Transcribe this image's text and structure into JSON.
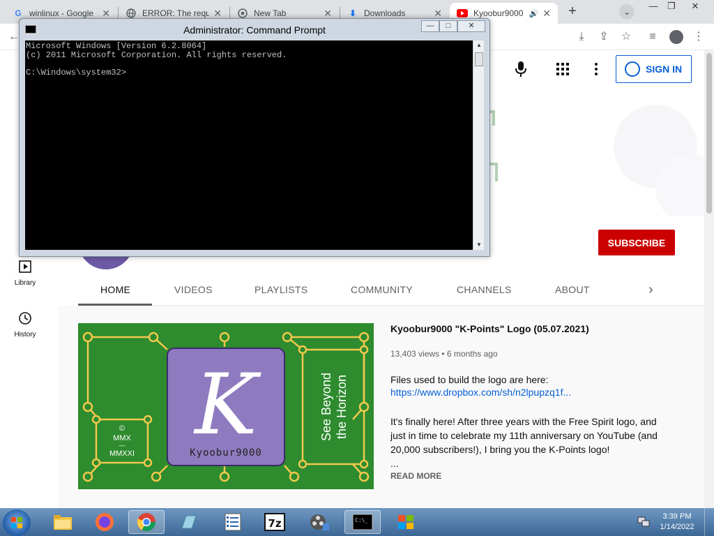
{
  "browser": {
    "tabs": [
      {
        "title": "winlinux - Google",
        "icon": "google-icon"
      },
      {
        "title": "ERROR: The requ",
        "icon": "globe-icon"
      },
      {
        "title": "New Tab",
        "icon": "chrome-icon"
      },
      {
        "title": "Downloads",
        "icon": "download-icon"
      },
      {
        "title": "Kyoobur9000",
        "icon": "youtube-icon",
        "active": true
      }
    ],
    "new_tab": "+",
    "window_controls": [
      "—",
      "❐",
      "✕"
    ]
  },
  "cmd": {
    "title": "Administrator: Command Prompt",
    "lines": [
      "Microsoft Windows [Version 6.2.8064]",
      "(c) 2011 Microsoft Corporation. All rights reserved.",
      "",
      "C:\\Windows\\system32>"
    ],
    "buttons": [
      "—",
      "□",
      "✕"
    ]
  },
  "youtube": {
    "sign_in": "SIGN IN",
    "subscribe": "SUBSCRIBE",
    "sidebar": [
      {
        "label": "Library",
        "icon": "library-icon"
      },
      {
        "label": "History",
        "icon": "history-icon"
      }
    ],
    "tabs": [
      "HOME",
      "VIDEOS",
      "PLAYLISTS",
      "COMMUNITY",
      "CHANNELS",
      "ABOUT"
    ],
    "active_tab": "HOME",
    "featured": {
      "title": "Kyoobur9000 \"K-Points\" Logo (05.07.2021)",
      "meta": "13,403 views • 6 months ago",
      "desc_intro": "Files used to build the logo are here:",
      "link": "https://www.dropbox.com/sh/n2lpupzq1f...",
      "paragraph": "It's finally here!  After three years with the Free Spirit logo, and just in time to celebrate my 11th anniversary on YouTube (and 20,000 subscribers!), I bring you the K-Points logo!",
      "ellipsis": "...",
      "read_more": "READ MORE",
      "thumb": {
        "copyright": "©",
        "year1": "MMX",
        "dash": "—",
        "year2": "MMXXI",
        "signature": "Kyoobur9000",
        "slogan1": "See Beyond",
        "slogan2": "the Horizon",
        "monogram": "K"
      }
    }
  },
  "taskbar": {
    "time": "3:39 PM",
    "date": "1/14/2022"
  },
  "colors": {
    "youtube_red": "#cc0000",
    "link_blue": "#065fd4",
    "thumb_green": "#2e8b2e",
    "thumb_purple": "#8e7bbf",
    "thumb_gold": "#f2c94c"
  }
}
